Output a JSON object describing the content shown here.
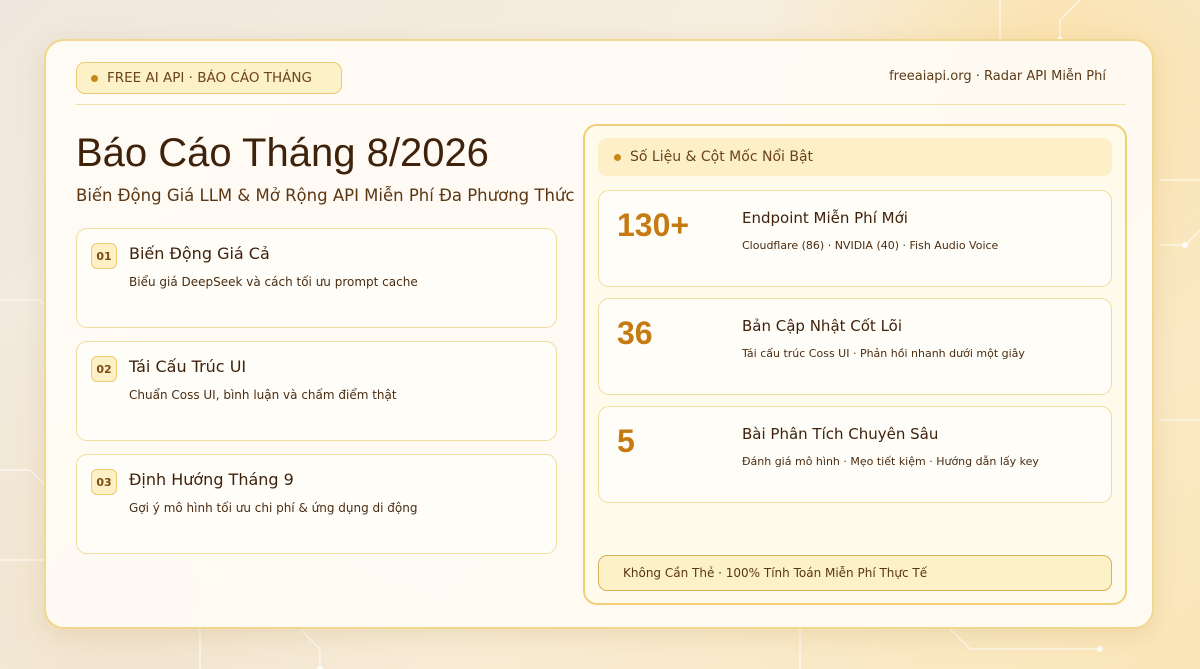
{
  "badge": {
    "label": "FREE AI API · BÁO CÁO THÁNG"
  },
  "site": {
    "label": "freeaiapi.org · Radar API Miễn Phí"
  },
  "title": "Báo Cáo Tháng 8/2026",
  "subtitle": "Biến Động Giá LLM & Mở Rộng API Miễn Phí Đa Phương Thức",
  "items": [
    {
      "num": "01",
      "title": "Biến Động Giá Cả",
      "desc": "Biểu giá DeepSeek và cách tối ưu prompt cache"
    },
    {
      "num": "02",
      "title": "Tái Cấu Trúc UI",
      "desc": "Chuẩn Coss UI, bình luận và chấm điểm thật"
    },
    {
      "num": "03",
      "title": "Định Hướng Tháng 9",
      "desc": "Gợi ý mô hình tối ưu chi phí & ứng dụng di động"
    }
  ],
  "panel": {
    "header": "Số Liệu & Cột Mốc Nổi Bật",
    "stats": [
      {
        "value": "130+",
        "title": "Endpoint Miễn Phí Mới",
        "desc": "Cloudflare (86) · NVIDIA (40) · Fish Audio Voice"
      },
      {
        "value": "36",
        "title": "Bản Cập Nhật Cốt Lõi",
        "desc": "Tái cấu trúc Coss UI · Phản hồi nhanh dưới một giây"
      },
      {
        "value": "5",
        "title": "Bài Phân Tích Chuyên Sâu",
        "desc": "Đánh giá mô hình · Mẹo tiết kiệm · Hướng dẫn lấy key"
      }
    ],
    "footer": "Không Cần Thẻ · 100% Tính Toán Miễn Phí Thực Tế"
  },
  "colors": {
    "accent": "#c57a12",
    "border": "#f1d88e",
    "card_bg": "#fffcf5",
    "badge_bg": "#fdf1c8"
  }
}
